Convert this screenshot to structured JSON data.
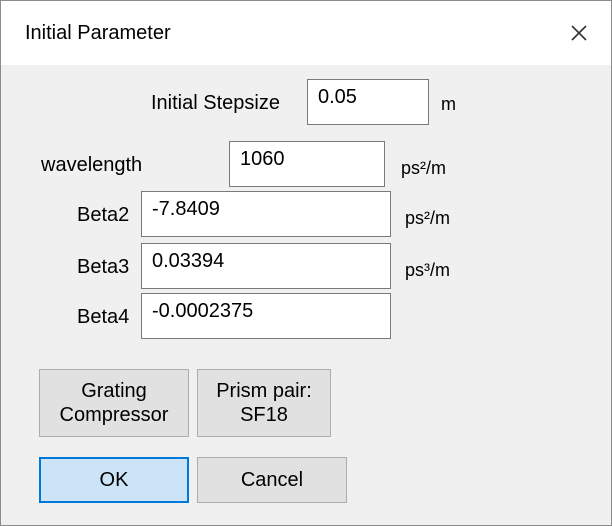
{
  "window": {
    "title": "Initial Parameter",
    "close_glyph": "✕"
  },
  "fields": {
    "stepsize": {
      "label": "Initial Stepsize",
      "value": "0.05",
      "unit": "m"
    },
    "wavelength": {
      "label": "wavelength",
      "value": "1060",
      "unit": "ps²/m"
    },
    "beta2": {
      "label": "Beta2",
      "value": "-7.8409",
      "unit": "ps²/m"
    },
    "beta3": {
      "label": "Beta3",
      "value": "0.03394",
      "unit": "ps³/m"
    },
    "beta4": {
      "label": "Beta4",
      "value": "-0.0002375"
    }
  },
  "buttons": {
    "grating_line1": "Grating",
    "grating_line2": "Compressor",
    "prism_line1": "Prism pair:",
    "prism_line2": "SF18",
    "ok": "OK",
    "cancel": "Cancel"
  },
  "colors": {
    "accent": "#0078d7",
    "default_button_bg": "#cce4f7",
    "window_bg": "#f0f0f0"
  }
}
